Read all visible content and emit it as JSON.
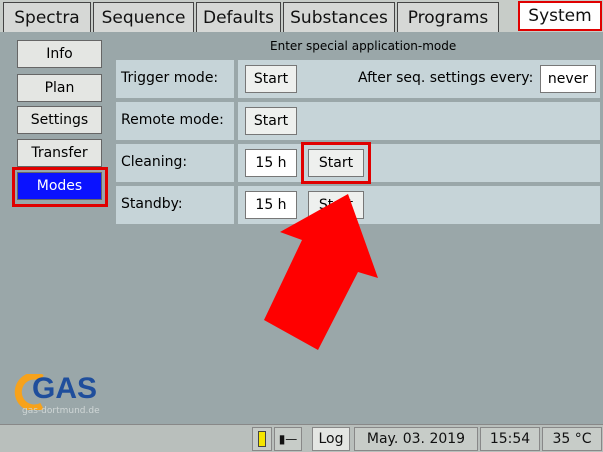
{
  "tabs": [
    "Spectra",
    "Sequence",
    "Defaults",
    "Substances",
    "Programs",
    "System"
  ],
  "active_tab": "System",
  "sidebar": {
    "items": [
      "Info",
      "Plan",
      "Settings",
      "Transfer",
      "Modes"
    ],
    "selected": "Modes"
  },
  "main": {
    "heading": "Enter special application-mode",
    "trigger": {
      "label": "Trigger mode:",
      "button": "Start",
      "after_label": "After seq. settings every:",
      "after_value": "never"
    },
    "remote": {
      "label": "Remote mode:",
      "button": "Start"
    },
    "cleaning": {
      "label": "Cleaning:",
      "value": "15 h",
      "button": "Start"
    },
    "standby": {
      "label": "Standby:",
      "value": "15 h",
      "button": "Start"
    }
  },
  "logo": {
    "text": "GAS",
    "subtext": "gas-dortmund.de"
  },
  "statusbar": {
    "log_button": "Log",
    "date": "May. 03. 2019",
    "time": "15:54",
    "temperature": "35 °C"
  },
  "colors": {
    "selected": "#0a12ff",
    "highlight": "#e00000",
    "arrow": "#ff0000",
    "logo_orange": "#f7a21b",
    "logo_blue": "#1f4e9c"
  }
}
